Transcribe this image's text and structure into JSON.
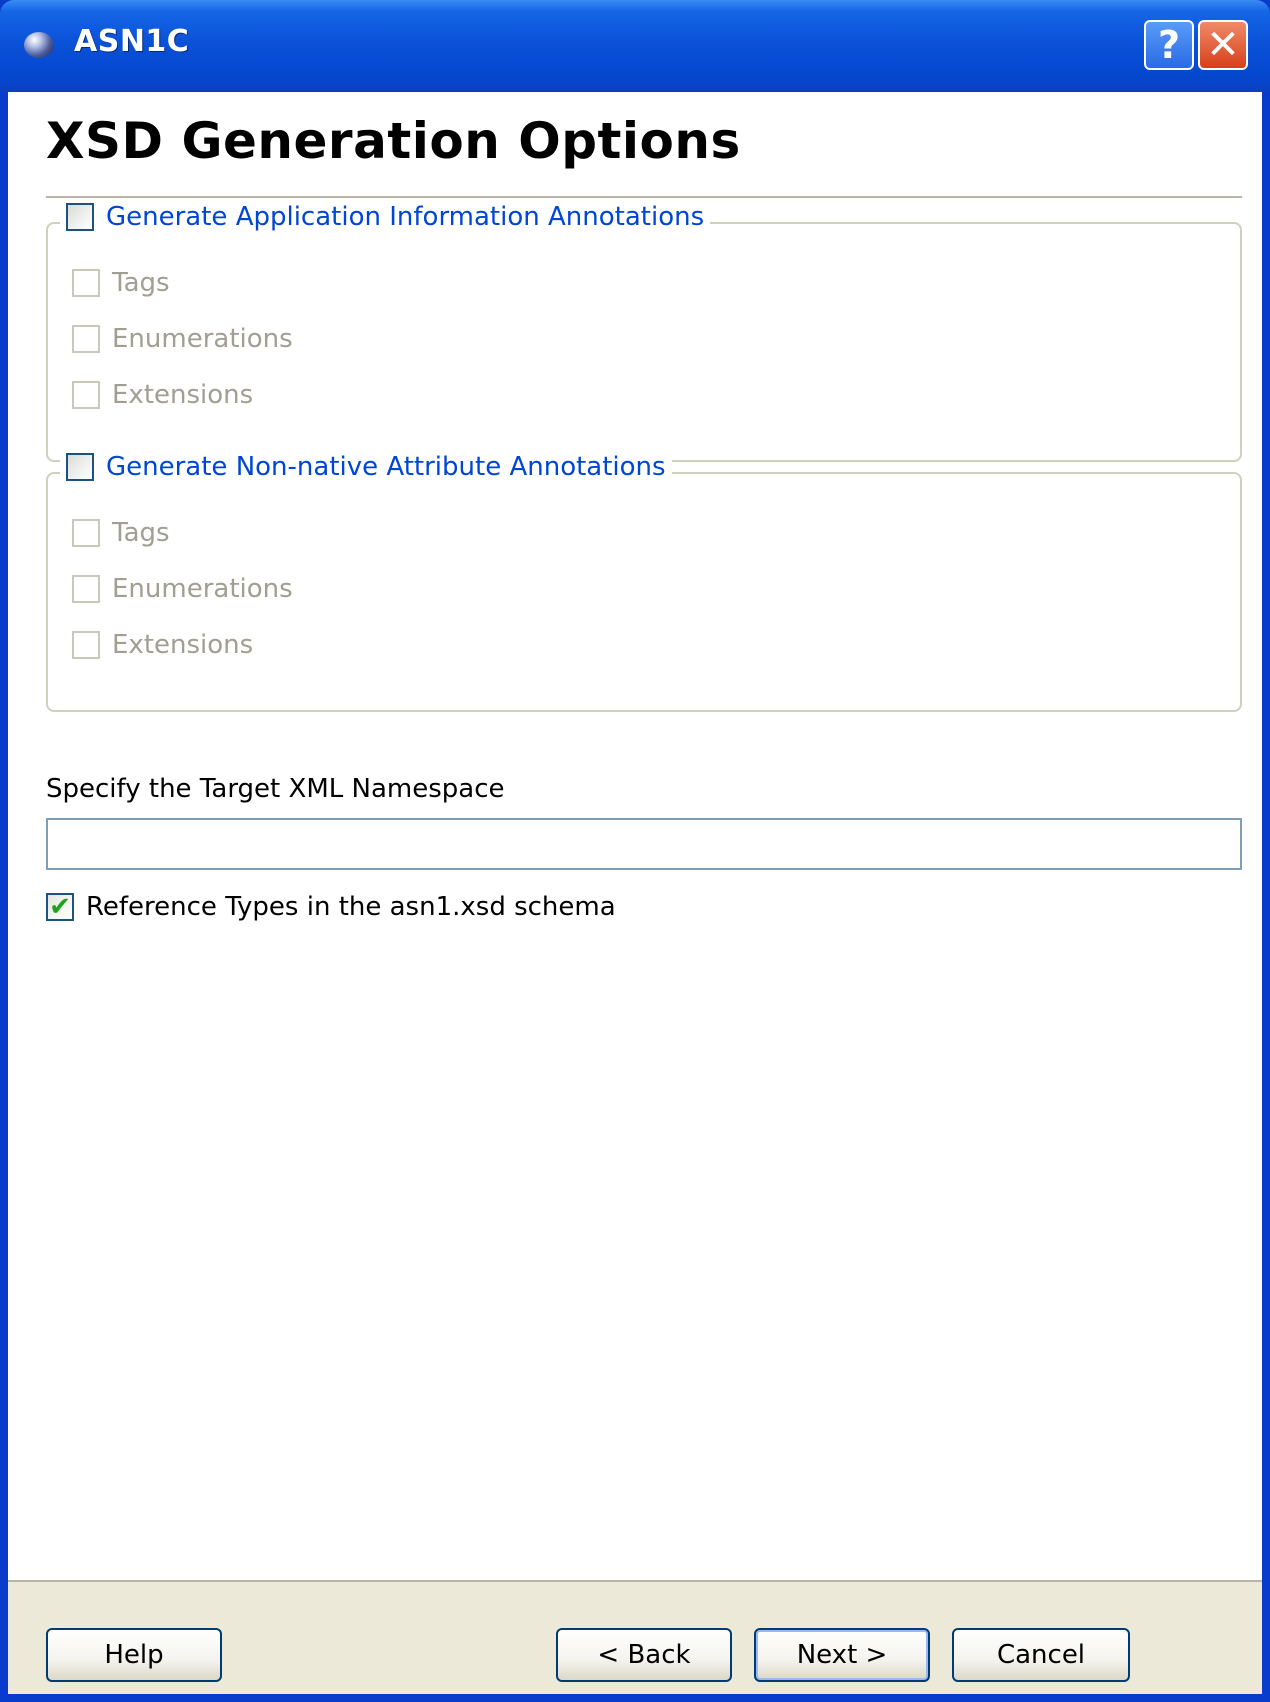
{
  "window": {
    "title": "ASN1C",
    "help_glyph": "?",
    "close_glyph": "✕"
  },
  "page": {
    "title": "XSD Generation Options"
  },
  "app_info_group": {
    "label": "Generate Application Information Annotations",
    "checked": false,
    "options": [
      {
        "label": "Tags"
      },
      {
        "label": "Enumerations"
      },
      {
        "label": "Extensions"
      }
    ]
  },
  "non_native_group": {
    "label": "Generate Non-native Attribute Annotations",
    "checked": false,
    "options": [
      {
        "label": "Tags"
      },
      {
        "label": "Enumerations"
      },
      {
        "label": "Extensions"
      }
    ]
  },
  "namespace": {
    "label": "Specify the Target XML Namespace",
    "value": ""
  },
  "reference": {
    "label": "Reference Types in the asn1.xsd schema",
    "checked": true,
    "check_glyph": "✔"
  },
  "footer": {
    "help": "Help",
    "back": "< Back",
    "next": "Next >",
    "cancel": "Cancel"
  }
}
